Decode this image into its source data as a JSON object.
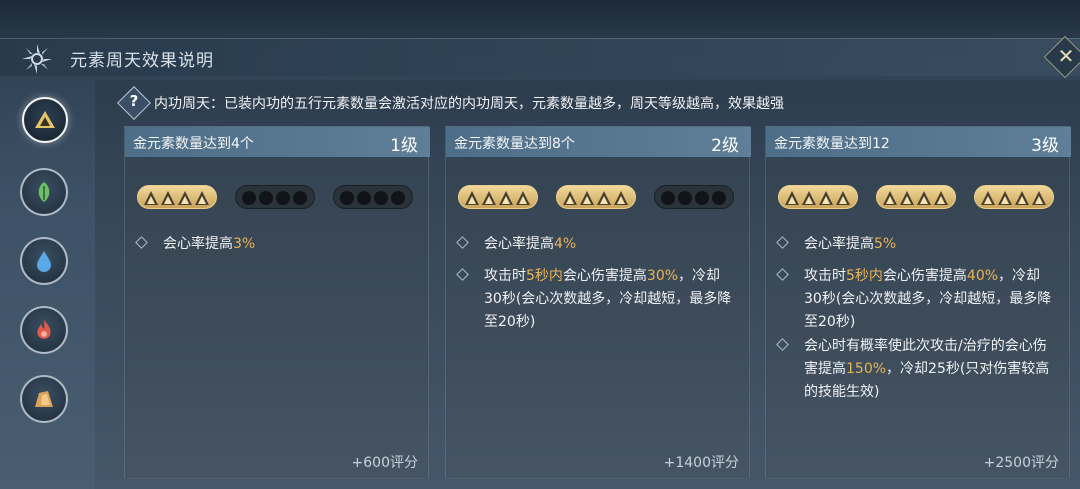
{
  "header": {
    "title": "元素周天效果说明",
    "close_label": "✕"
  },
  "notice": {
    "icon_text": "?",
    "text": "内功周天：已装内功的五行元素数量会激活对应的内功周天，元素数量越多，周天等级越高，效果越强"
  },
  "elements": [
    {
      "name": "metal",
      "icon": "metal-triangle-icon",
      "color": "#e6c46a",
      "active": true
    },
    {
      "name": "wood",
      "icon": "leaf-icon",
      "color": "#6fbf6a",
      "active": false
    },
    {
      "name": "water",
      "icon": "water-drop-icon",
      "color": "#5aa8e6",
      "active": false
    },
    {
      "name": "fire",
      "icon": "flame-icon",
      "color": "#e25a4a",
      "active": false
    },
    {
      "name": "earth",
      "icon": "rock-icon",
      "color": "#d9a15a",
      "active": false
    }
  ],
  "cards": [
    {
      "title": "金元素数量达到4个",
      "level": "1级",
      "pips_active_groups": 1,
      "effects": [
        {
          "parts": [
            [
              "会心率提高",
              false
            ],
            [
              "3%",
              true
            ]
          ]
        }
      ],
      "score": "+600评分"
    },
    {
      "title": "金元素数量达到8个",
      "level": "2级",
      "pips_active_groups": 2,
      "effects": [
        {
          "parts": [
            [
              "会心率提高",
              false
            ],
            [
              "4%",
              true
            ]
          ]
        },
        {
          "parts": [
            [
              "攻击时",
              false
            ],
            [
              "5秒内",
              true
            ],
            [
              "会心伤害提高",
              false
            ],
            [
              "30%",
              true
            ],
            [
              "，冷却30秒(会心次数越多，冷却越短，最多降至20秒)",
              false
            ]
          ]
        }
      ],
      "score": "+1400评分"
    },
    {
      "title": "金元素数量达到12",
      "level": "3级",
      "pips_active_groups": 3,
      "effects": [
        {
          "parts": [
            [
              "会心率提高",
              false
            ],
            [
              "5%",
              true
            ]
          ]
        },
        {
          "parts": [
            [
              "攻击时",
              false
            ],
            [
              "5秒内",
              true
            ],
            [
              "会心伤害提高",
              false
            ],
            [
              "40%",
              true
            ],
            [
              "，冷却30秒(会心次数越多，冷却越短，最多降至20秒)",
              false
            ]
          ]
        },
        {
          "parts": [
            [
              "会心时有概率使此次攻击/治疗的会心伤害提高",
              false
            ],
            [
              "150%",
              true
            ],
            [
              "，冷却25秒(只对伤害较高的技能生效)",
              false
            ]
          ]
        }
      ],
      "score": "+2500评分"
    }
  ]
}
